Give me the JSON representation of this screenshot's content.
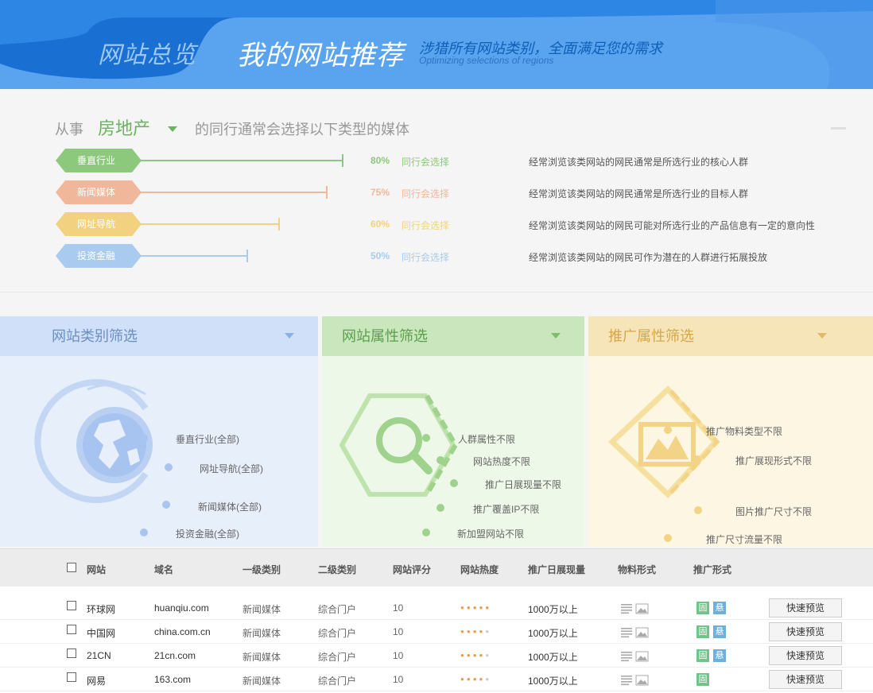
{
  "banner": {
    "overview_tab": "网站总览",
    "title": "我的网站推荐",
    "subtitle": "涉猎所有网站类别，全面满足您的需求",
    "subtitle_en": "Optimizing selections of regions"
  },
  "lead": {
    "prefix": "从事",
    "industry": "房地产",
    "suffix": "的同行通常会选择以下类型的媒体"
  },
  "media_rows": [
    {
      "tag": "垂直行业",
      "percent": "80%",
      "fill": 0.8,
      "choose": "同行会选择",
      "desc": "经常浏览该类网站的网民通常是所选行业的核心人群",
      "color": "#8cc97c"
    },
    {
      "tag": "新闻媒体",
      "percent": "75%",
      "fill": 0.75,
      "choose": "同行会选择",
      "desc": "经常浏览该类网站的网民通常是所选行业的目标人群",
      "color": "#f0b79b"
    },
    {
      "tag": "网址导航",
      "percent": "60%",
      "fill": 0.6,
      "choose": "同行会选择",
      "desc": "经常浏览该类网站的网民可能对所选行业的产品信息有一定的意向性",
      "color": "#f2d27e"
    },
    {
      "tag": "投资金融",
      "percent": "50%",
      "fill": 0.5,
      "choose": "同行会选择",
      "desc": "经常浏览该类网站的网民可作为潜在的人群进行拓展投放",
      "color": "#a9cbef"
    }
  ],
  "filters": {
    "category": {
      "title": "网站类别筛选",
      "items": [
        "垂直行业(全部)",
        "网址导航(全部)",
        "新闻媒体(全部)",
        "投资金融(全部)"
      ]
    },
    "attribute": {
      "title": "网站属性筛选",
      "items": [
        "人群属性不限",
        "网站热度不限",
        "推广日展现量不限",
        "推广覆盖IP不限",
        "新加盟网站不限"
      ]
    },
    "promotion": {
      "title": "推广属性筛选",
      "items": [
        "推广物料类型不限",
        "推广展现形式不限",
        "图片推广尺寸不限",
        "推广尺寸流量不限"
      ]
    }
  },
  "table": {
    "headers": [
      "网站",
      "域名",
      "一级类别",
      "二级类别",
      "网站评分",
      "网站热度",
      "推广日展现量",
      "物料形式",
      "推广形式"
    ],
    "rows": [
      {
        "site": "环球网",
        "domain": "huanqiu.com",
        "cat1": "新闻媒体",
        "cat2": "综合门户",
        "score": "10",
        "stars": 5,
        "views": "1000万以上",
        "fixed": "固",
        "float": "悬",
        "preview": "快速预览"
      },
      {
        "site": "中国网",
        "domain": "china.com.cn",
        "cat1": "新闻媒体",
        "cat2": "综合门户",
        "score": "10",
        "stars": 4,
        "views": "1000万以上",
        "fixed": "固",
        "float": "悬",
        "preview": "快速预览"
      },
      {
        "site": "21CN",
        "domain": "21cn.com",
        "cat1": "新闻媒体",
        "cat2": "综合门户",
        "score": "10",
        "stars": 4,
        "views": "1000万以上",
        "fixed": "固",
        "float": "悬",
        "preview": "快速预览"
      },
      {
        "site": "网易",
        "domain": "163.com",
        "cat1": "新闻媒体",
        "cat2": "综合门户",
        "score": "10",
        "stars": 4,
        "views": "1000万以上",
        "fixed": "固",
        "float": "",
        "preview": "快速预览"
      }
    ]
  },
  "colors": {
    "banner": "#5aa3ee",
    "green": "#6bb35e",
    "star_on": "#e99a4a",
    "star_off": "#cccccc",
    "badge_fixed": "#6fc48a",
    "badge_float": "#6fb0d8"
  },
  "icons": [
    "globe-icon",
    "search-icon",
    "image-icon",
    "text-lines-icon"
  ]
}
